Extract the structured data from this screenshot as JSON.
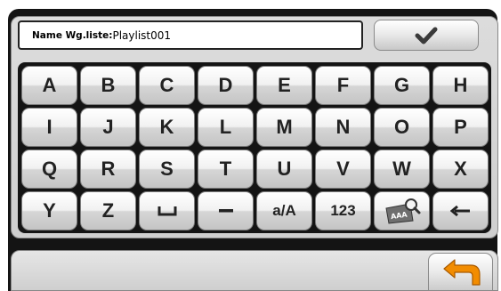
{
  "input": {
    "label": "Name Wg.liste:",
    "value": "Playlist001"
  },
  "confirm": {
    "icon": "checkmark-icon"
  },
  "keyboard": {
    "rows": [
      [
        "A",
        "B",
        "C",
        "D",
        "E",
        "F",
        "G",
        "H"
      ],
      [
        "I",
        "J",
        "K",
        "L",
        "M",
        "N",
        "O",
        "P"
      ],
      [
        "Q",
        "R",
        "S",
        "T",
        "U",
        "V",
        "W",
        "X"
      ],
      [
        "Y",
        "Z",
        "space",
        "dash",
        "a/A",
        "123",
        "aaa-magnifier",
        "backspace"
      ]
    ],
    "case_label": "a/A",
    "numbers_label": "123"
  },
  "back": {
    "icon": "back-arrow-icon",
    "color": "#f28c00"
  },
  "colors": {
    "frame": "#141414",
    "accent": "#f28c00"
  }
}
